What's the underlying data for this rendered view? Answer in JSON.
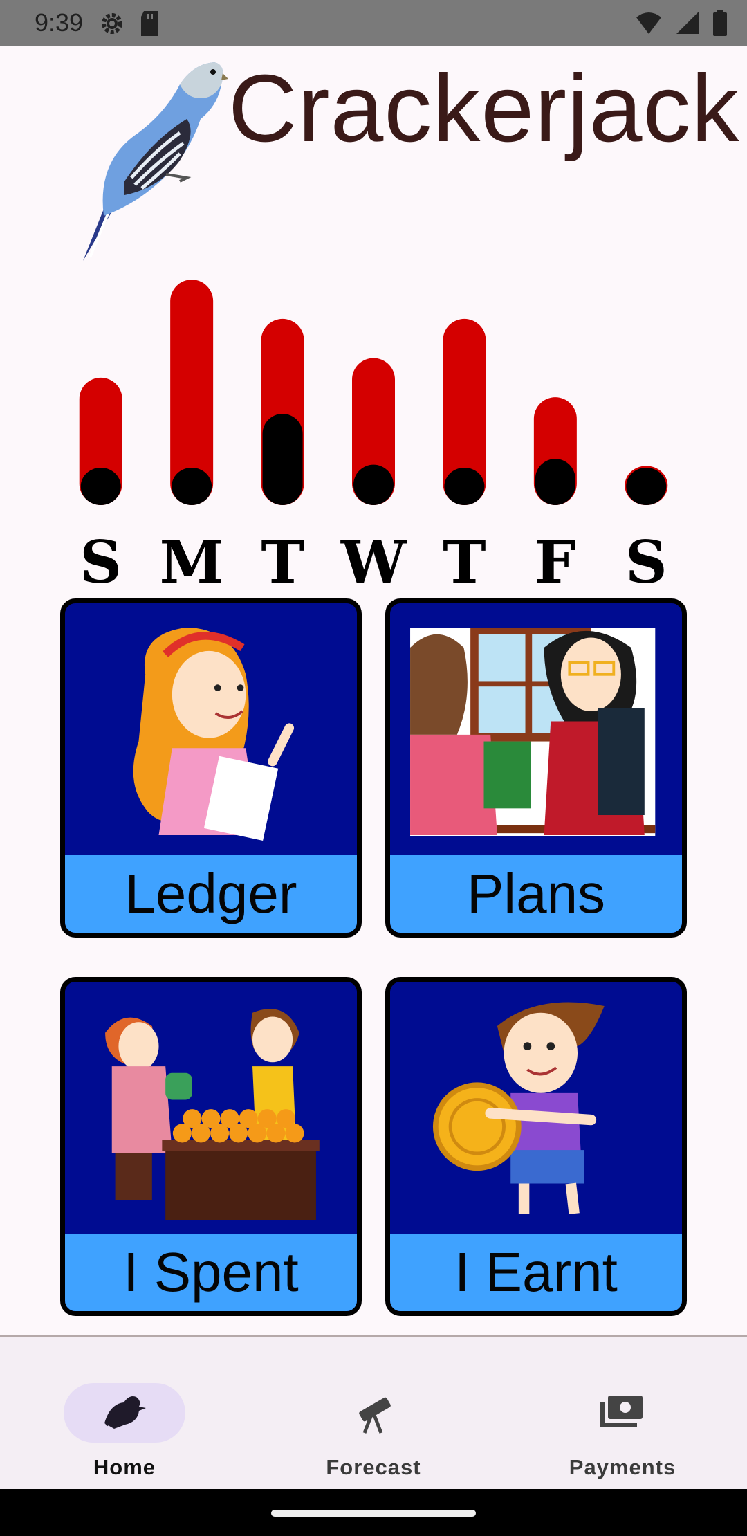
{
  "status_bar": {
    "time": "9:39",
    "left_icons": [
      "settings-gear-icon",
      "sd-card-icon"
    ],
    "right_icons": [
      "wifi-icon",
      "signal-icon",
      "battery-icon"
    ]
  },
  "header": {
    "title": "Crackerjack",
    "logo": "budgie-bird-logo"
  },
  "chart_data": {
    "type": "bar",
    "categories": [
      "S",
      "M",
      "T",
      "W",
      "T",
      "F",
      "S"
    ],
    "series": [
      {
        "values": [
          6.5,
          11.5,
          9.5,
          7.5,
          9.5,
          5.5,
          2.0
        ],
        "color": "#d40000"
      },
      {
        "values": [
          0.0,
          2.0,
          4.8,
          2.2,
          0.0,
          2.5,
          0.5
        ],
        "color": "#000000"
      }
    ],
    "ylim": [
      0,
      12
    ],
    "grid": false,
    "xlabel": "",
    "ylabel": ""
  },
  "tiles": [
    {
      "id": "ledger",
      "label": "Ledger",
      "art": "girl-writing-list"
    },
    {
      "id": "plans",
      "label": "Plans",
      "art": "teacher-and-girl-with-books"
    },
    {
      "id": "spent",
      "label": "I Spent",
      "art": "kids-buying-oranges"
    },
    {
      "id": "earnt",
      "label": "I Earnt",
      "art": "boy-holding-coin"
    }
  ],
  "bottom_nav": {
    "items": [
      {
        "label": "Home",
        "icon": "bird-icon",
        "active": true
      },
      {
        "label": "Forecast",
        "icon": "telescope-icon",
        "active": false
      },
      {
        "label": "Payments",
        "icon": "money-icon",
        "active": false
      }
    ]
  },
  "colors": {
    "tile_bg": "#000c91",
    "tile_label_bg": "#3fa2ff",
    "bar_red": "#d40000",
    "bar_black": "#000000",
    "title": "#3a1a18",
    "nav_active_pill": "#e6dcf5"
  }
}
